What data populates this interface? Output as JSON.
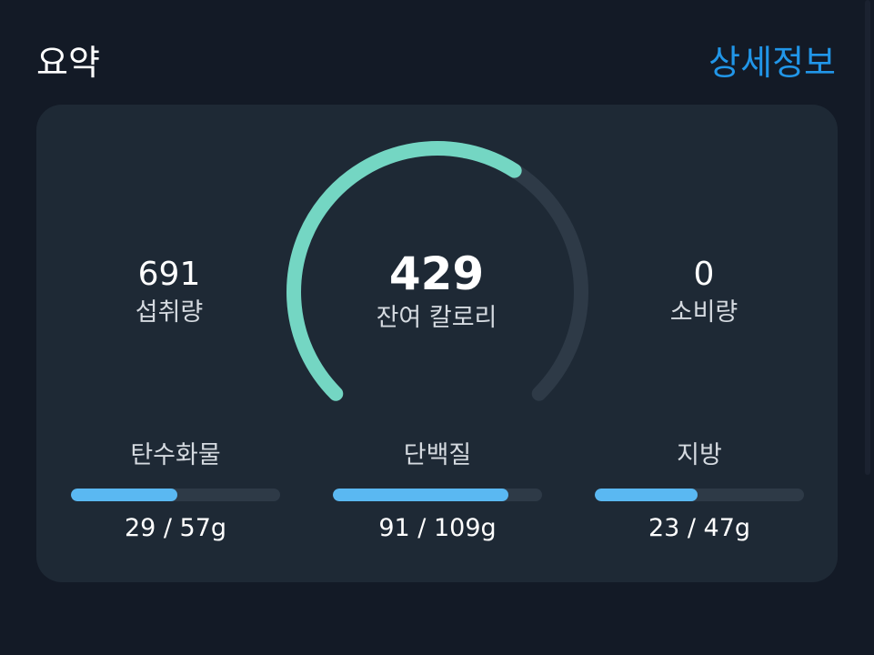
{
  "header": {
    "title": "요약",
    "detail_link": "상세정보"
  },
  "summary": {
    "intake": {
      "value": "691",
      "label": "섭취량"
    },
    "remaining": {
      "value": "429",
      "label": "잔여 칼로리"
    },
    "burned": {
      "value": "0",
      "label": "소비량"
    },
    "progress_fraction": 0.62
  },
  "macros": [
    {
      "name": "탄수화물",
      "amount": "29 / 57g",
      "fraction": 0.51
    },
    {
      "name": "단백질",
      "amount": "91 / 109g",
      "fraction": 0.84
    },
    {
      "name": "지방",
      "amount": "23 / 47g",
      "fraction": 0.49
    }
  ],
  "colors": {
    "background": "#131a26",
    "card": "#1e2935",
    "accent_link": "#2196e8",
    "gauge_fill": "#74d6c3",
    "gauge_track": "#2e3a47",
    "macro_fill": "#5ab8f2"
  }
}
